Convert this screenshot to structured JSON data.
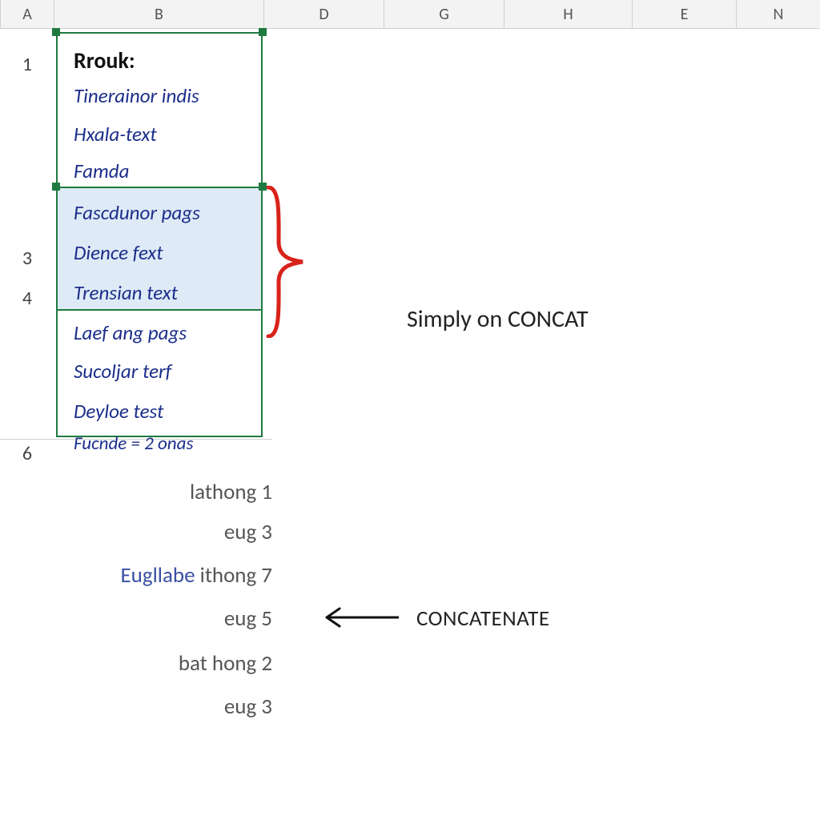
{
  "columns": {
    "A": "A",
    "B": "B",
    "D": "D",
    "G": "G",
    "H": "H",
    "E": "E",
    "N": "N"
  },
  "row_numbers": {
    "r1": "1",
    "r3": "3",
    "r4": "4",
    "r6": "6"
  },
  "cells": {
    "b1": "Rrouk:",
    "b2": "Tinerainor indis",
    "b3": "Hxala-text",
    "b4": "Famda",
    "b5": "Fascdunor pags",
    "b6": "Dience fext",
    "b7": "Trensian text",
    "b8": "Laef ang pags",
    "b9": "Sucoljar terf",
    "b10": "Deyloe test",
    "b11": "Fucnde = 2 onas"
  },
  "annotation": {
    "concat_hint": "Simply on CONCAT",
    "concatenate": "CONCATENATE"
  },
  "lower_list": {
    "l1": "lathong 1",
    "l2": "eug 3",
    "l3_prefix": "Eugllabe",
    "l3_rest": "ithong 7",
    "l4": "eug 5",
    "l5": "bat hong 2",
    "l6": "eug 3"
  }
}
